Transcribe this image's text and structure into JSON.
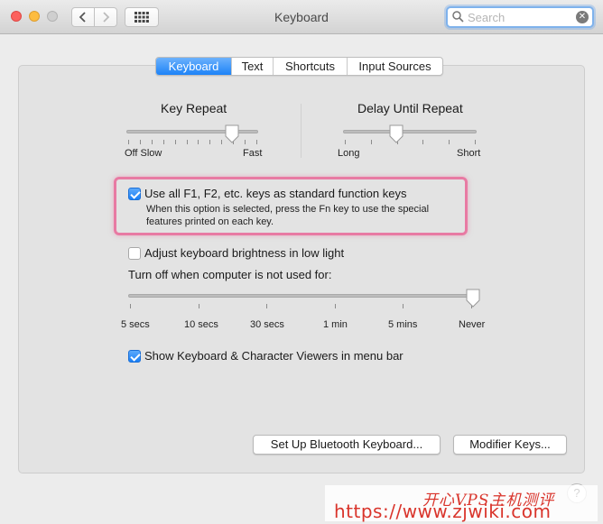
{
  "window": {
    "title": "Keyboard"
  },
  "search": {
    "placeholder": "Search",
    "value": ""
  },
  "tabs": [
    {
      "label": "Keyboard",
      "active": true
    },
    {
      "label": "Text",
      "active": false
    },
    {
      "label": "Shortcuts",
      "active": false
    },
    {
      "label": "Input Sources",
      "active": false
    }
  ],
  "key_repeat": {
    "label": "Key Repeat",
    "min_label": "Off Slow",
    "max_label": "Fast",
    "value": 0.8
  },
  "delay_until_repeat": {
    "label": "Delay Until Repeat",
    "min_label": "Long",
    "max_label": "Short",
    "value": 0.4
  },
  "fn_keys": {
    "label": "Use all F1, F2, etc. keys as standard function keys",
    "checked": true,
    "help_line1": "When this option is selected, press the Fn key to use the special",
    "help_line2": "features printed on each key."
  },
  "brightness": {
    "label": "Adjust keyboard brightness in low light",
    "checked": false
  },
  "turn_off": {
    "label": "Turn off when computer is not used for:",
    "ticks": [
      "5 secs",
      "10 secs",
      "30 secs",
      "1 min",
      "5 mins",
      "Never"
    ],
    "value": "Never"
  },
  "viewers": {
    "label": "Show Keyboard & Character Viewers in menu bar",
    "checked": true
  },
  "buttons": {
    "bluetooth": "Set Up Bluetooth Keyboard...",
    "modifier": "Modifier Keys...",
    "help": "?"
  },
  "watermark": {
    "line1": "开心VPS主机测评",
    "line2": "https://www.zjwiki.com"
  }
}
